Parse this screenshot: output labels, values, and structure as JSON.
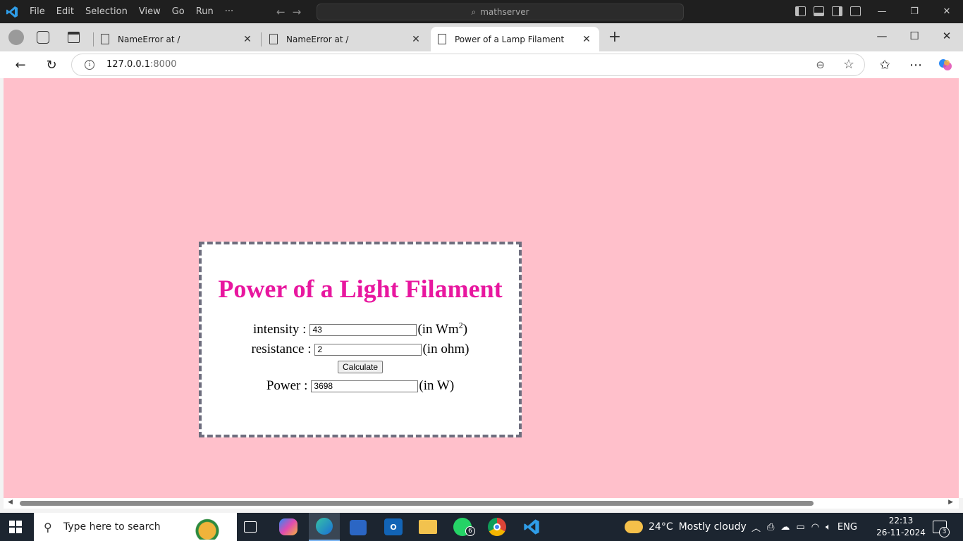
{
  "vscode": {
    "menu": [
      "File",
      "Edit",
      "Selection",
      "View",
      "Go",
      "Run",
      "···"
    ],
    "command_center": "mathserver"
  },
  "browser": {
    "tabs": [
      {
        "title": "NameError at /",
        "active": false
      },
      {
        "title": "NameError at /",
        "active": false
      },
      {
        "title": "Power of a Lamp Filament",
        "active": true
      }
    ],
    "url_host": "127.0.0.1",
    "url_port": ":8000"
  },
  "page": {
    "background": "#ffc0cb",
    "heading": "Power of a Light Filament",
    "heading_color": "#e8179f",
    "intensity": {
      "label": "intensity :",
      "value": "43",
      "unit_prefix": "(in Wm",
      "unit_sup": "2",
      "unit_suffix": ")"
    },
    "resistance": {
      "label": "resistance :",
      "value": "2",
      "unit": "(in ohm)"
    },
    "calculate_label": "Calculate",
    "power": {
      "label": "Power :",
      "value": "3698",
      "unit": "(in W)"
    }
  },
  "taskbar": {
    "search_placeholder": "Type here to search",
    "whatsapp_badge": "6",
    "weather_temp": "24°C",
    "weather_text": "Mostly cloudy",
    "language": "ENG",
    "time": "22:13",
    "date": "26-11-2024",
    "notification_count": "3"
  }
}
